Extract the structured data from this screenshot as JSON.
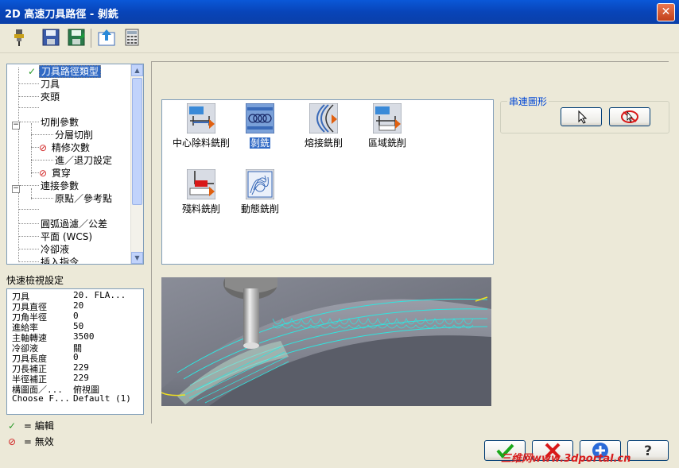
{
  "window": {
    "title": "2D 高速刀具路徑 - 剝銑",
    "close": "✕"
  },
  "tree": {
    "items": [
      {
        "label": "刀具路徑類型",
        "selected": true,
        "icon": "check-icon"
      },
      {
        "label": "刀具"
      },
      {
        "label": "夾頭"
      },
      {
        "label": ""
      },
      {
        "label": "切削參數",
        "expander": "−"
      },
      {
        "label": "分層切削"
      },
      {
        "label": "精修次數",
        "icon": "disabled-icon"
      },
      {
        "label": "進／退刀設定"
      },
      {
        "label": "貫穿",
        "icon": "disabled-icon"
      },
      {
        "label": "連接參數",
        "expander": "−"
      },
      {
        "label": "原點／參考點"
      },
      {
        "label": ""
      },
      {
        "label": "圓弧過濾／公差"
      },
      {
        "label": "平面 (WCS)"
      },
      {
        "label": "冷卻液"
      },
      {
        "label": "插入指令"
      }
    ]
  },
  "quick_view": {
    "title": "快速檢視設定",
    "rows": [
      {
        "k": "刀具",
        "v": "20. FLA..."
      },
      {
        "k": "刀具直徑",
        "v": "20"
      },
      {
        "k": "刀角半徑",
        "v": "0"
      },
      {
        "k": "進給率",
        "v": "50"
      },
      {
        "k": "主軸轉速",
        "v": "3500"
      },
      {
        "k": "冷卻液",
        "v": "關"
      },
      {
        "k": "刀具長度",
        "v": "0"
      },
      {
        "k": "刀長補正",
        "v": "229"
      },
      {
        "k": "半徑補正",
        "v": "229"
      },
      {
        "k": "構圖面／...",
        "v": "俯視圖"
      },
      {
        "k": "Choose F...",
        "v": "Default (1)"
      }
    ]
  },
  "legend": {
    "edit": "= 編輯",
    "disabled": "= 無效"
  },
  "toolpath_types": [
    {
      "label": "中心除料銑削",
      "icon": "core-mill-icon"
    },
    {
      "label": "剝銑",
      "icon": "peel-mill-icon",
      "selected": true
    },
    {
      "label": "熔接銑削",
      "icon": "blend-mill-icon"
    },
    {
      "label": "區域銑削",
      "icon": "area-mill-icon"
    },
    {
      "label": "殘料銑削",
      "icon": "rest-mill-icon"
    },
    {
      "label": "動態銑削",
      "icon": "dynamic-mill-icon"
    }
  ],
  "chain_group": {
    "title": "串連圖形"
  },
  "watermark": "三维网www.3dportal.cn"
}
